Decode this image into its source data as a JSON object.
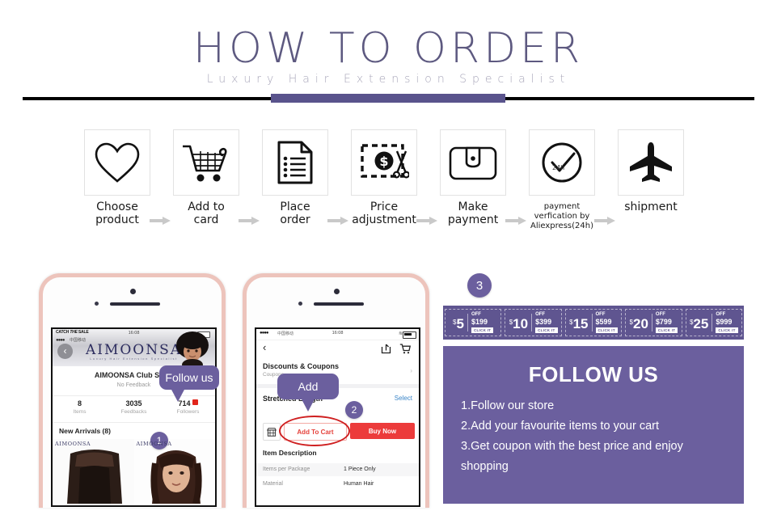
{
  "header": {
    "title": "HOW TO ORDER",
    "subtitle": "Luxury Hair Extension Specialist"
  },
  "steps": [
    {
      "icon": "heart-icon",
      "label": "Choose\nproduct"
    },
    {
      "icon": "cart-icon",
      "label": "Add to\ncard"
    },
    {
      "icon": "document-icon",
      "label": "Place\norder"
    },
    {
      "icon": "price-cut-icon",
      "label": "Price\nadjustment"
    },
    {
      "icon": "wallet-icon",
      "label": "Make\npayment"
    },
    {
      "icon": "clock-check-icon",
      "label": "payment\nverfication by\nAliexpress(24h)"
    },
    {
      "icon": "airplane-icon",
      "label": "shipment"
    }
  ],
  "phone_one": {
    "status_time": "16:08",
    "banner_tag": "CATCH THE SALE",
    "brand": "AIMOONSA",
    "brand_sub": "Luxury Hair Extension Specialist",
    "store_name": "AIMOONSA Club Store",
    "feedback": "No Feedback",
    "stats": [
      {
        "value": "8",
        "label": "Items"
      },
      {
        "value": "3035",
        "label": "Feedbacks"
      },
      {
        "value": "714",
        "label": "Followers"
      }
    ],
    "section": "New Arrivals (8)",
    "watermark": "AIMOONSA",
    "bubble": "Follow us",
    "badge": "1"
  },
  "phone_two": {
    "status_time": "16:08",
    "rows": [
      {
        "title": "Discounts & Coupons",
        "sub": "Coupons"
      },
      {
        "title": "Stretched Length",
        "action": "Select"
      }
    ],
    "add_to_cart": "Add To Cart",
    "buy_now": "Buy Now",
    "description_title": "Item Description",
    "description_rows": [
      {
        "key": "Items per Package",
        "value": "1 Piece Only"
      },
      {
        "key": "Material",
        "value": "Human Hair"
      }
    ],
    "bubble": "Add",
    "badge": "2"
  },
  "right_panel": {
    "badge": "3",
    "coupons": [
      {
        "amount": "5",
        "currency": "$",
        "off": "OFF",
        "min": "$199",
        "click": "CLICK IT"
      },
      {
        "amount": "10",
        "currency": "$",
        "off": "OFF",
        "min": "$399",
        "click": "CLICK IT"
      },
      {
        "amount": "15",
        "currency": "$",
        "off": "OFF",
        "min": "$599",
        "click": "CLICK IT"
      },
      {
        "amount": "20",
        "currency": "$",
        "off": "OFF",
        "min": "$799",
        "click": "CLICK IT"
      },
      {
        "amount": "25",
        "currency": "$",
        "off": "OFF",
        "min": "$999",
        "click": "CLICK IT"
      }
    ],
    "follow_title": "FOLLOW US",
    "follow_lines": [
      "1.Follow our store",
      "2.Add your favourite items to your cart",
      "3.Get coupon with the best price and enjoy",
      "shopping"
    ]
  },
  "colors": {
    "purple_panel": "#6b5f9e",
    "purple_strip": "#5f5590",
    "purple_title": "#5d5980",
    "purple_rule": "#59538c",
    "subtitle_gray": "#a9a7ba",
    "red_button": "#ec3b3b",
    "phone_frame": "#edc4bc"
  }
}
